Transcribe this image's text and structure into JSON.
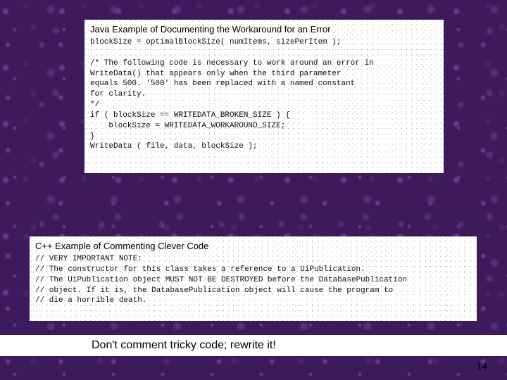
{
  "box1": {
    "title": "Java Example of Documenting the Workaround for an Error",
    "lines": [
      "blockSize = optimalBlockSize( numItems, sizePerItem );",
      "",
      "/* The following code is necessary to work around an error in",
      "WriteData() that appears only when the third parameter",
      "equals 500. '500' has been replaced with a named constant",
      "for clarity.",
      "*/",
      "if ( blockSize == WRITEDATA_BROKEN_SIZE ) {",
      "    blockSize = WRITEDATA_WORKAROUND_SIZE;",
      "}",
      "WriteData ( file, data, blockSize );"
    ]
  },
  "box2": {
    "title": "C++ Example of Commenting Clever Code",
    "lines": [
      "// VERY IMPORTANT NOTE:",
      "// The constructor for this class takes a reference to a UiPublication.",
      "// The UiPublication object MUST NOT BE DESTROYED before the DatabasePublication",
      "// object. If it is, the DatabasePublication object will cause the program to",
      "// die a horrible death."
    ]
  },
  "caption": "Don't comment tricky code; rewrite it!",
  "page_number": "14"
}
